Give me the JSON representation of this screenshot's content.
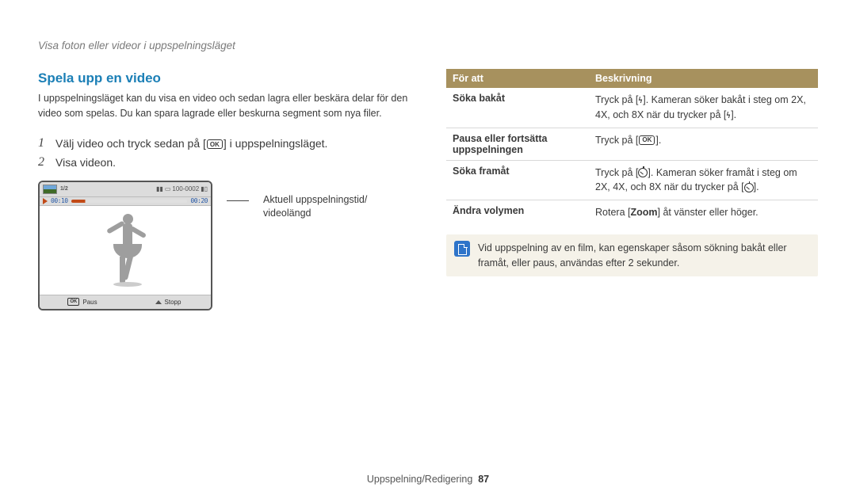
{
  "breadcrumb": "Visa foton eller videor i uppspelningsläget",
  "section_title": "Spela upp en video",
  "intro": "I uppspelningsläget kan du visa en video och sedan lagra eller beskära delar för den video som spelas. Du kan spara lagrade eller beskurna segment som nya filer.",
  "steps": {
    "s1_num": "1",
    "s1_pre": "Välj video och tryck sedan på [",
    "s1_ok": "OK",
    "s1_post": "] i uppspelningsläget.",
    "s2_num": "2",
    "s2_text": "Visa videon."
  },
  "callout": "Aktuell uppspelningstid/\nvideolängd",
  "frame": {
    "counter": "1/2",
    "battery_label": "100-0002",
    "time_current": "00:10",
    "time_total": "00:20",
    "btn_ok": "OK",
    "btn_pause": "Paus",
    "btn_stop": "Stopp"
  },
  "table": {
    "th1": "För att",
    "th2": "Beskrivning",
    "rows": [
      {
        "left": "Söka bakåt",
        "right_pre": "Tryck på [",
        "right_icon": "flash",
        "right_mid": "]. Kameran söker bakåt i steg om 2X, 4X, och 8X när du trycker på [",
        "right_icon2": "flash",
        "right_post": "]."
      },
      {
        "left": "Pausa eller fortsätta uppspelningen",
        "right_pre": "Tryck på [",
        "right_icon": "ok",
        "right_mid": "",
        "right_icon2": "",
        "right_post": "]."
      },
      {
        "left": "Söka framåt",
        "right_pre": "Tryck på [",
        "right_icon": "timer",
        "right_mid": "]. Kameran söker framåt i steg om 2X, 4X, och 8X när du trycker på [",
        "right_icon2": "timer",
        "right_post": "]."
      },
      {
        "left": "Ändra volymen",
        "right_pre": "Rotera [",
        "right_bold": "Zoom",
        "right_post": "] åt vänster eller höger."
      }
    ]
  },
  "info_note": "Vid uppspelning av en film, kan egenskaper såsom sökning bakåt eller framåt, eller paus, användas efter 2 sekunder.",
  "footer_text": "Uppspelning/Redigering",
  "footer_page": "87"
}
